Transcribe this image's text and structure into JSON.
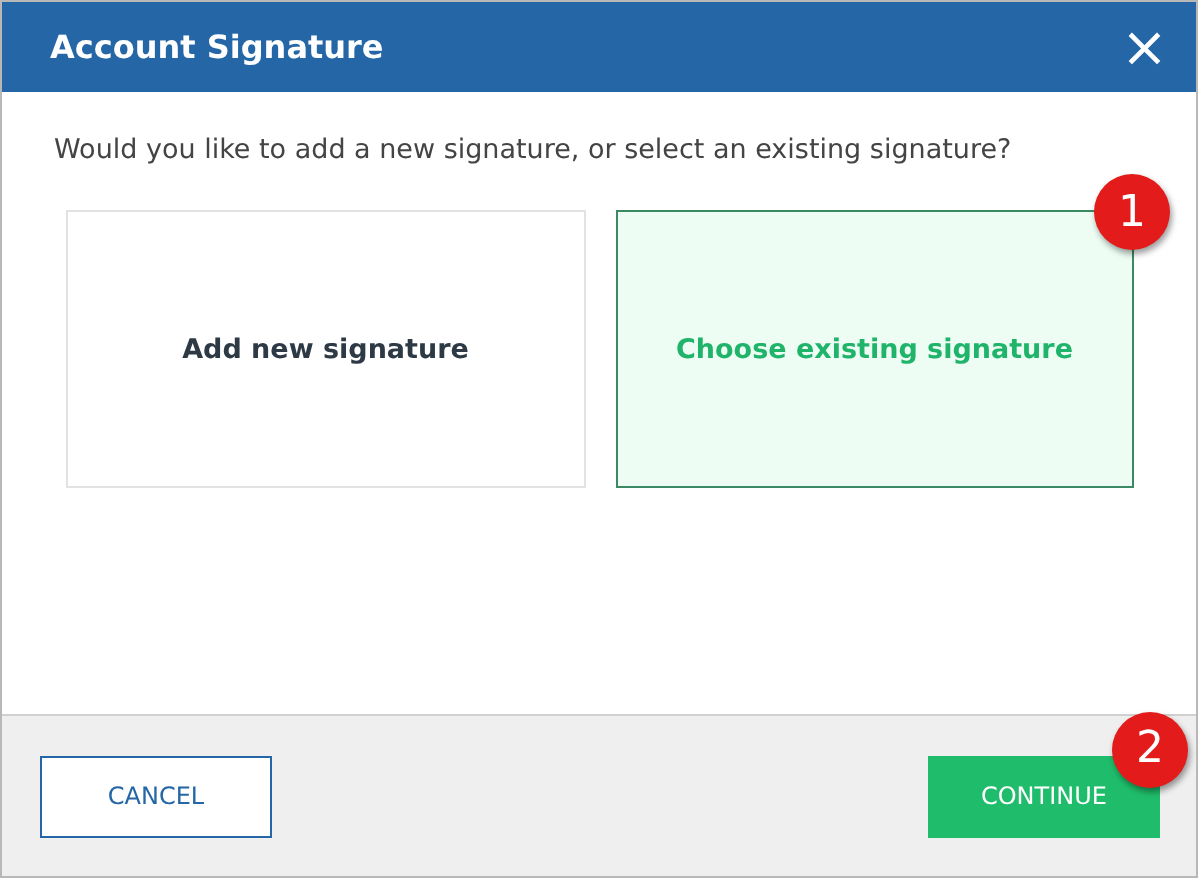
{
  "window": {
    "title": "Account Signature",
    "close": "×"
  },
  "prompt": "Would you like to add a new signature, or select an existing signature?",
  "options": [
    {
      "label": "Add new signature",
      "selected": false
    },
    {
      "label": "Choose existing signature",
      "selected": true,
      "callout": "1"
    }
  ],
  "buttons": [
    {
      "label": "CANCEL",
      "kind": "secondary"
    },
    {
      "label": "CONTINUE",
      "kind": "primary",
      "callout": "2"
    }
  ]
}
